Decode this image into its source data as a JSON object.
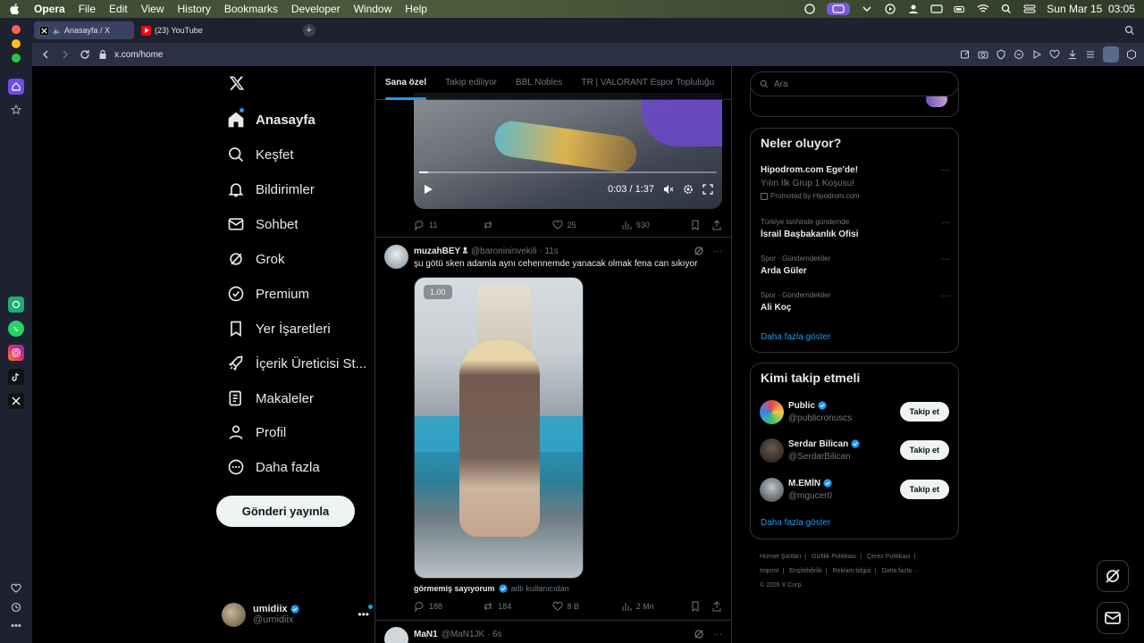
{
  "menubar": {
    "items": [
      "Opera",
      "File",
      "Edit",
      "View",
      "History",
      "Bookmarks",
      "Developer",
      "Window",
      "Help"
    ],
    "clock": "Sun Mar 15  03:05"
  },
  "tabs": [
    {
      "label": "Anasayfa / X"
    },
    {
      "label": "(23) YouTube"
    }
  ],
  "address": {
    "url": "x.com/home"
  },
  "nav": {
    "items": [
      {
        "label": "Anasayfa"
      },
      {
        "label": "Keşfet"
      },
      {
        "label": "Bildirimler"
      },
      {
        "label": "Sohbet"
      },
      {
        "label": "Grok"
      },
      {
        "label": "Premium"
      },
      {
        "label": "Yer İşaretleri"
      },
      {
        "label": "İçerik Üreticisi St..."
      },
      {
        "label": "Makaleler"
      },
      {
        "label": "Profil"
      },
      {
        "label": "Daha fazla"
      }
    ],
    "post_button": "Gönderi yayınla",
    "account": {
      "name": "umidiix",
      "handle": "@umidiix",
      "more": "•••"
    }
  },
  "timeline": {
    "tabs": [
      "Sana özel",
      "Takip ediliyor",
      "BBL Nobles",
      "TR | VALORANT Espor Topluluğu"
    ],
    "video1": {
      "time": "0:03 / 1:37",
      "progress": 0.03
    },
    "post1_actions": {
      "replies": "11",
      "reposts": "",
      "likes": "25",
      "views": "930"
    },
    "post2": {
      "name": "muzahBEY 🕱",
      "handle": "@baronininvekili",
      "time": "· 11s",
      "text": "şu götü sken adamla aynı cehennemde yanacak olmak fena can sıkıyor",
      "video_badge": "1.00",
      "caption_name": "görmemiş sayıyorum",
      "caption_suffix": "adlı kullanıcıdan",
      "replies": "188",
      "reposts": "184",
      "likes": "8 B",
      "views": "2 Mn"
    },
    "post3": {
      "name": "MaN1",
      "handle": "@MaN1JK",
      "time": "· 6s"
    }
  },
  "right": {
    "search_placeholder": "Ara",
    "trends_title": "Neler oluyor?",
    "trends": [
      {
        "title": "Hipodrom.com Ege'de!",
        "sub": "Yılın İlk Grup 1 Koşusu!",
        "promo": "Promoted by Hipodrom.com"
      },
      {
        "cat": "Türkiye tarihinde gündemde",
        "title": "İsrail Başbakanlık Ofisi"
      },
      {
        "cat": "Spor · Gündemdekiler",
        "title": "Arda Güler"
      },
      {
        "cat": "Spor · Gündemdekiler",
        "title": "Ali Koç"
      }
    ],
    "trends_more": "Daha fazla göster",
    "follow_title": "Kimi takip etmeli",
    "follow": [
      {
        "name": "Public",
        "handle": "@publicronuscs",
        "button": "Takip et"
      },
      {
        "name": "Serdar Bilican",
        "handle": "@SerdarBilican",
        "button": "Takip et"
      },
      {
        "name": "M.EMİN",
        "handle": "@mgucer0",
        "button": "Takip et"
      }
    ],
    "follow_more": "Daha fazla göster",
    "footer": [
      "Hizmet Şartları",
      "|",
      "Gizlilik Politikası",
      "|",
      "Çerez Politikası",
      "|",
      "Imprint",
      "|",
      "Erişilebilirlik",
      "|",
      "Reklam bilgisi",
      "|",
      "Daha fazla ···",
      "© 2026 X Corp."
    ]
  },
  "colors": {
    "accent": "#1d9bf0",
    "bg": "#000000",
    "opera_chrome": "#1e2130"
  }
}
